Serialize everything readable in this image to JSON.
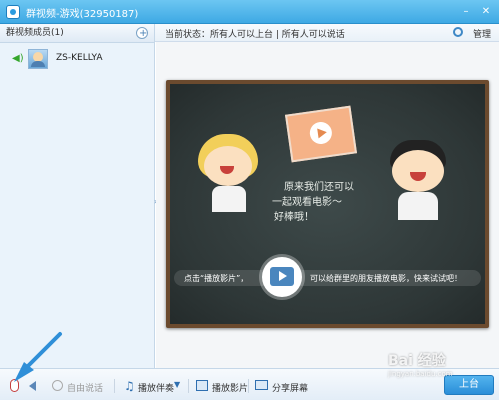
{
  "window": {
    "title": "群视频-游戏(32950187)"
  },
  "sidebar": {
    "header": "群视频成员(1)",
    "members": [
      {
        "name": "ZS-KELLYA"
      }
    ]
  },
  "status_bar": {
    "status": "当前状态：所有人可以上台 | 所有人可以说话",
    "manage": "管理"
  },
  "board": {
    "line1": "原来我们还可以",
    "line2": "一起观看电影～",
    "line3": "好棒哦！",
    "hint_left": "点击“播放影片”，",
    "hint_right": "可以给群里的朋友播放电影，快来试试吧！"
  },
  "toolbar": {
    "free_talk": "自由说话",
    "music": "播放伴奏",
    "movie": "播放影片",
    "share_screen": "分享屏幕",
    "upstage": "上台"
  },
  "watermark": {
    "main": "Bai 经验",
    "sub": "jingyan.baidu.com"
  },
  "colors": {
    "titlebar": "#3ea9e4",
    "accent": "#2a8ed8",
    "arrow": "#2f8fd8"
  }
}
